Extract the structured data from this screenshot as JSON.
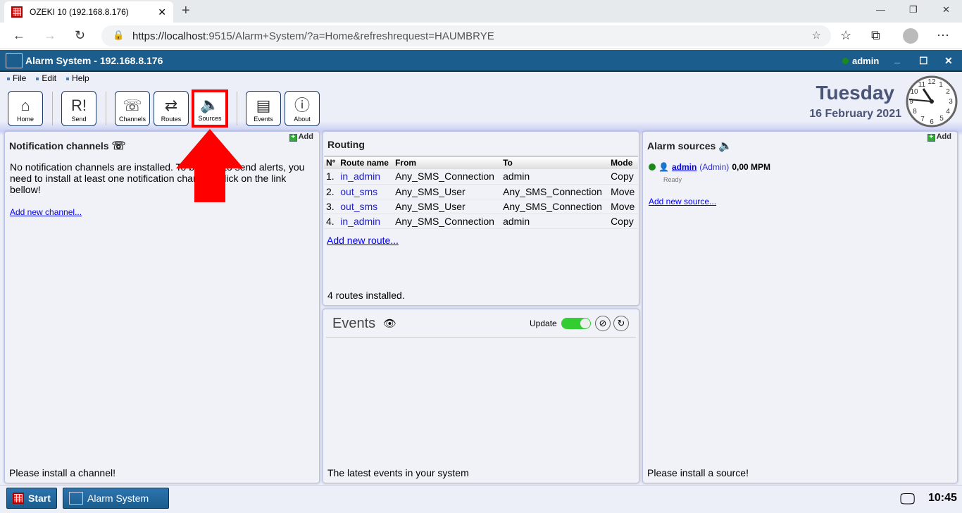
{
  "browser": {
    "tab_title": "OZEKI 10 (192.168.8.176)",
    "url_host": "https://localhost",
    "url_rest": ":9515/Alarm+System/?a=Home&refreshrequest=HAUMBRYE"
  },
  "app": {
    "title": "Alarm System - 192.168.8.176",
    "user": "admin",
    "status_color": "#1a8a1a"
  },
  "menu": [
    "File",
    "Edit",
    "Help"
  ],
  "toolbar": [
    {
      "label": "Home",
      "icon": "home-icon",
      "glyph": "⌂"
    },
    {
      "label": "Send",
      "icon": "send-person-icon",
      "glyph": "R!"
    },
    {
      "label": "Channels",
      "icon": "channels-icon",
      "glyph": "☏"
    },
    {
      "label": "Routes",
      "icon": "routes-signpost-icon",
      "glyph": "⇄"
    },
    {
      "label": "Sources",
      "icon": "speaker-icon",
      "glyph": "🔈"
    },
    {
      "label": "Events",
      "icon": "events-list-icon",
      "glyph": "▤"
    },
    {
      "label": "About",
      "icon": "info-icon",
      "glyph": "ⓘ"
    }
  ],
  "highlight_color": "#ff0000",
  "clock": {
    "day": "Tuesday",
    "date": "16 February 2021",
    "time": "10:45"
  },
  "channels": {
    "title": "Notification channels",
    "add": "Add",
    "message": "No notification channels are installed. To be able to send alerts, you need to install at least one notification channel. Click on the link bellow!",
    "link": "Add new channel...",
    "footer": "Please install a channel!"
  },
  "routing": {
    "title": "Routing",
    "columns": [
      "N°",
      "Route name",
      "From",
      "To",
      "Mode"
    ],
    "rows": [
      [
        "1.",
        "in_admin",
        "Any_SMS_Connection",
        "admin",
        "Copy"
      ],
      [
        "2.",
        "out_sms",
        "Any_SMS_User",
        "Any_SMS_Connection",
        "Move"
      ],
      [
        "3.",
        "out_sms",
        "Any_SMS_User",
        "Any_SMS_Connection",
        "Move"
      ],
      [
        "4.",
        "in_admin",
        "Any_SMS_Connection",
        "admin",
        "Copy"
      ]
    ],
    "link": "Add new route...",
    "footer": "4 routes installed."
  },
  "events": {
    "title": "Events",
    "update": "Update",
    "update_on": true,
    "footer": "The latest events in your system"
  },
  "sources": {
    "title": "Alarm sources",
    "add": "Add",
    "item": {
      "name": "admin",
      "type": "(Admin)",
      "rate": "0,00 MPM",
      "status": "Ready"
    },
    "link": "Add new source...",
    "footer": "Please install a source!"
  },
  "taskbar": {
    "start": "Start",
    "app": "Alarm System",
    "time": "10:45"
  }
}
